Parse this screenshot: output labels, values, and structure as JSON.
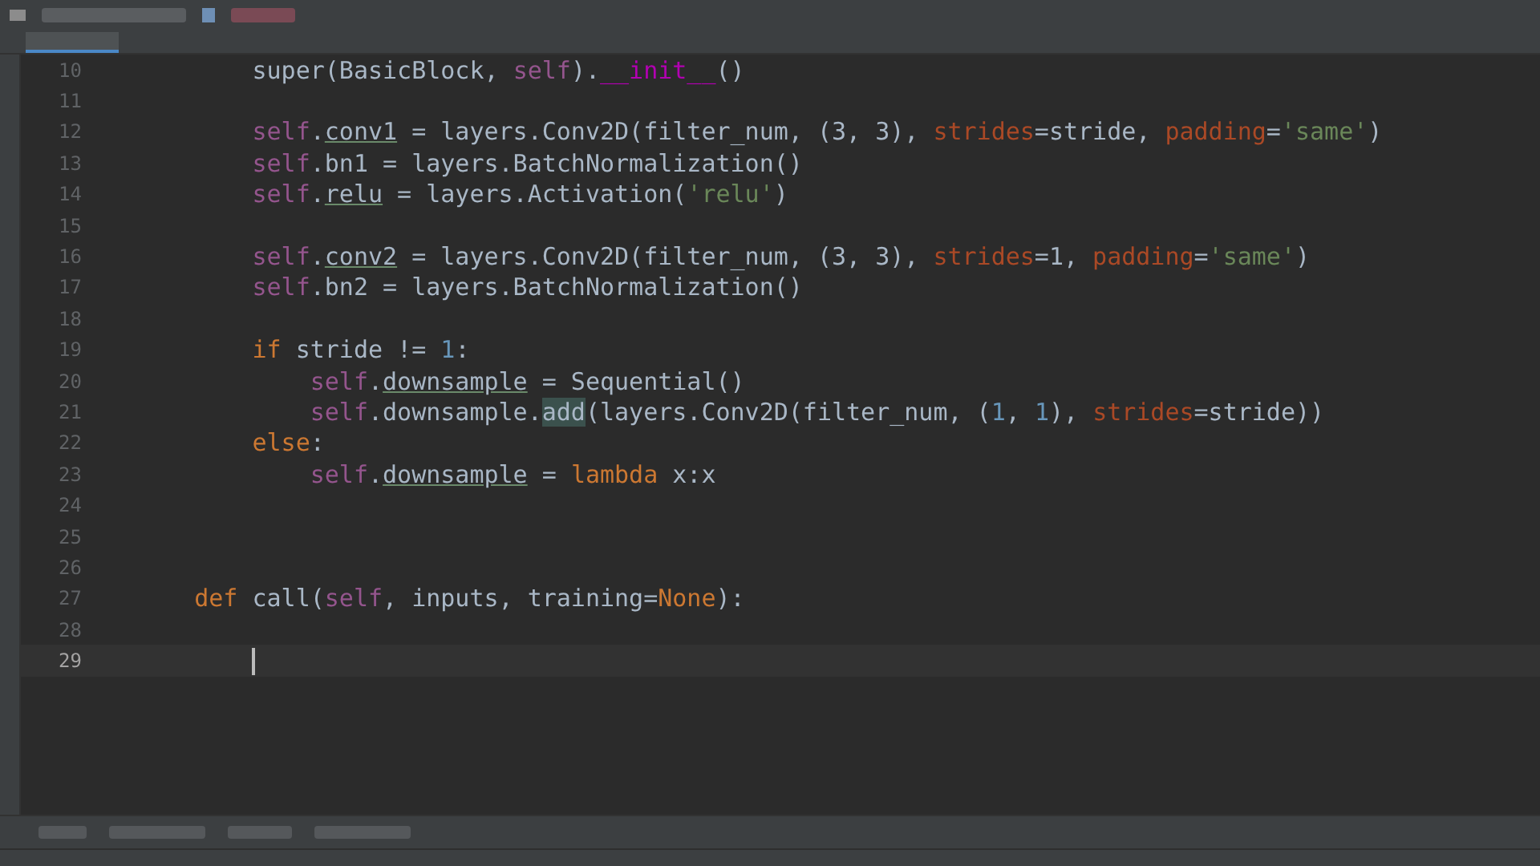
{
  "editor": {
    "lines": [
      {
        "number": "10",
        "current": false,
        "tokens": [
          {
            "kind": "plain",
            "text": "        super(BasicBlock, "
          },
          {
            "kind": "self",
            "text": "self"
          },
          {
            "kind": "plain",
            "text": ")."
          },
          {
            "kind": "magic",
            "text": "__init__"
          },
          {
            "kind": "plain",
            "text": "()"
          }
        ]
      },
      {
        "number": "11",
        "current": false
      },
      {
        "number": "12",
        "current": false,
        "tokens": [
          {
            "kind": "self",
            "text": "        self"
          },
          {
            "kind": "plain",
            "text": "."
          },
          {
            "kind": "attr",
            "text": "conv1"
          },
          {
            "kind": "plain",
            "text": " = layers.Conv2D(filter_num, (3, 3), "
          },
          {
            "kind": "param",
            "text": "strides"
          },
          {
            "kind": "plain",
            "text": "=stride, "
          },
          {
            "kind": "param",
            "text": "padding"
          },
          {
            "kind": "plain",
            "text": "="
          },
          {
            "kind": "string",
            "text": "'same'"
          },
          {
            "kind": "plain",
            "text": ")"
          }
        ]
      },
      {
        "number": "13",
        "current": false,
        "tokens": [
          {
            "kind": "self",
            "text": "        self"
          },
          {
            "kind": "plain",
            "text": ".bn1 = layers.BatchNormalization()"
          }
        ]
      },
      {
        "number": "14",
        "current": false,
        "tokens": [
          {
            "kind": "self",
            "text": "        self"
          },
          {
            "kind": "plain",
            "text": "."
          },
          {
            "kind": "attr",
            "text": "relu"
          },
          {
            "kind": "plain",
            "text": " = layers.Activation("
          },
          {
            "kind": "string",
            "text": "'relu'"
          },
          {
            "kind": "plain",
            "text": ")"
          }
        ]
      },
      {
        "number": "15",
        "current": false
      },
      {
        "number": "16",
        "current": false,
        "tokens": [
          {
            "kind": "self",
            "text": "        self"
          },
          {
            "kind": "plain",
            "text": "."
          },
          {
            "kind": "attr",
            "text": "conv2"
          },
          {
            "kind": "plain",
            "text": " = layers.Conv2D(filter_num, (3, 3), "
          },
          {
            "kind": "param",
            "text": "strides"
          },
          {
            "kind": "plain",
            "text": "=1, "
          },
          {
            "kind": "param",
            "text": "padding"
          },
          {
            "kind": "plain",
            "text": "="
          },
          {
            "kind": "string",
            "text": "'same'"
          },
          {
            "kind": "plain",
            "text": ")"
          }
        ]
      },
      {
        "number": "17",
        "current": false,
        "tokens": [
          {
            "kind": "self",
            "text": "        self"
          },
          {
            "kind": "plain",
            "text": ".bn2 = layers.BatchNormalization()"
          }
        ]
      },
      {
        "number": "18",
        "current": false
      },
      {
        "number": "19",
        "current": false,
        "tokens": [
          {
            "kind": "keyword",
            "text": "        if"
          },
          {
            "kind": "plain",
            "text": " stride != "
          },
          {
            "kind": "number",
            "text": "1"
          },
          {
            "kind": "plain",
            "text": ":"
          }
        ]
      },
      {
        "number": "20",
        "current": false,
        "tokens": [
          {
            "kind": "self",
            "text": "            self"
          },
          {
            "kind": "plain",
            "text": "."
          },
          {
            "kind": "attr",
            "text": "downsample"
          },
          {
            "kind": "plain",
            "text": " = Sequential()"
          }
        ]
      },
      {
        "number": "21",
        "current": false,
        "tokens": [
          {
            "kind": "self",
            "text": "            self"
          },
          {
            "kind": "plain",
            "text": ".downsample."
          },
          {
            "kind": "match",
            "text": "add"
          },
          {
            "kind": "plain",
            "text": "(layers.Conv2D(filter_num, ("
          },
          {
            "kind": "number",
            "text": "1"
          },
          {
            "kind": "plain",
            "text": ", "
          },
          {
            "kind": "number",
            "text": "1"
          },
          {
            "kind": "plain",
            "text": "), "
          },
          {
            "kind": "param",
            "text": "strides"
          },
          {
            "kind": "plain",
            "text": "=stride))"
          }
        ]
      },
      {
        "number": "22",
        "current": false,
        "tokens": [
          {
            "kind": "keyword",
            "text": "        else"
          },
          {
            "kind": "plain",
            "text": ":"
          }
        ]
      },
      {
        "number": "23",
        "current": false,
        "tokens": [
          {
            "kind": "self",
            "text": "            self"
          },
          {
            "kind": "plain",
            "text": "."
          },
          {
            "kind": "attr",
            "text": "downsample"
          },
          {
            "kind": "plain",
            "text": " = "
          },
          {
            "kind": "keyword",
            "text": "lambda"
          },
          {
            "kind": "plain",
            "text": " x:x"
          }
        ]
      },
      {
        "number": "24",
        "current": false
      },
      {
        "number": "25",
        "current": false
      },
      {
        "number": "26",
        "current": false
      },
      {
        "number": "27",
        "current": false,
        "tokens": [
          {
            "kind": "keyword",
            "text": "    def"
          },
          {
            "kind": "plain",
            "text": " call("
          },
          {
            "kind": "self",
            "text": "self"
          },
          {
            "kind": "plain",
            "text": ", inputs, training="
          },
          {
            "kind": "keyword",
            "text": "None"
          },
          {
            "kind": "plain",
            "text": "):"
          }
        ]
      },
      {
        "number": "28",
        "current": false
      },
      {
        "number": "29",
        "current": true
      }
    ]
  }
}
